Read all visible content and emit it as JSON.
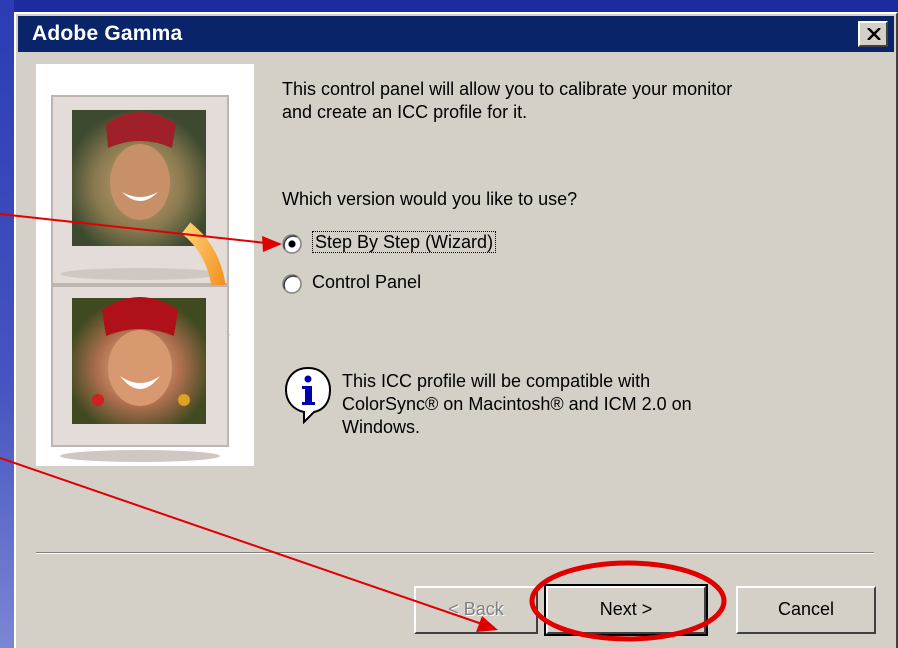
{
  "window": {
    "title": "Adobe Gamma",
    "close_icon": "close-icon"
  },
  "intro_text": "This control panel will allow you to calibrate your monitor and create an ICC profile for it.",
  "question": "Which version would you like to use?",
  "options": [
    {
      "label": "Step By Step (Wizard)",
      "selected": true
    },
    {
      "label": "Control Panel",
      "selected": false
    }
  ],
  "info": {
    "icon": "info-icon",
    "text": "This ICC profile will be compatible with ColorSync® on Macintosh® and ICM 2.0 on Windows."
  },
  "buttons": {
    "back": "< Back",
    "next": "Next >",
    "cancel": "Cancel"
  },
  "colors": {
    "background_blue": "#1c2c9c",
    "titlebar": "#0a246a",
    "dialog_face": "#d4d0c8",
    "annotation_red": "#e00000"
  }
}
